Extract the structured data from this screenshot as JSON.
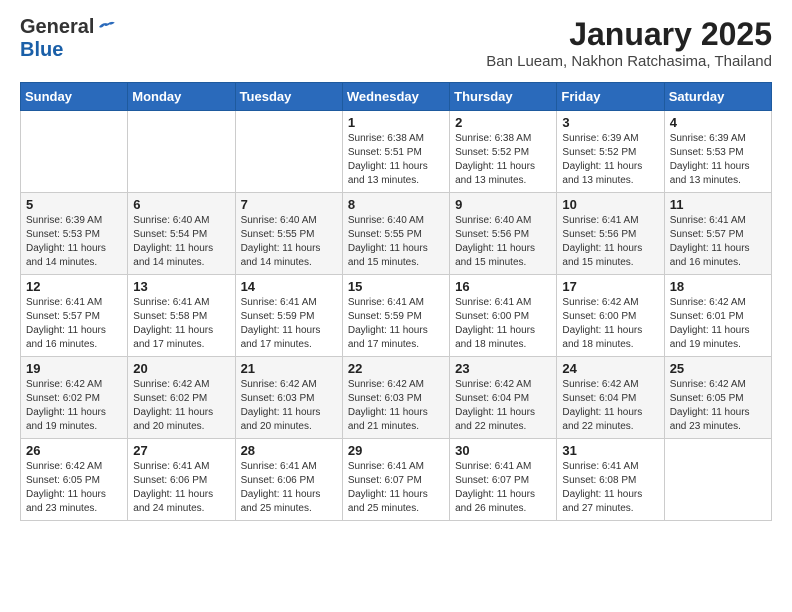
{
  "header": {
    "logo_general": "General",
    "logo_blue": "Blue",
    "month_title": "January 2025",
    "subtitle": "Ban Lueam, Nakhon Ratchasima, Thailand"
  },
  "days_of_week": [
    "Sunday",
    "Monday",
    "Tuesday",
    "Wednesday",
    "Thursday",
    "Friday",
    "Saturday"
  ],
  "weeks": [
    [
      {
        "day": "",
        "info": ""
      },
      {
        "day": "",
        "info": ""
      },
      {
        "day": "",
        "info": ""
      },
      {
        "day": "1",
        "info": "Sunrise: 6:38 AM\nSunset: 5:51 PM\nDaylight: 11 hours\nand 13 minutes."
      },
      {
        "day": "2",
        "info": "Sunrise: 6:38 AM\nSunset: 5:52 PM\nDaylight: 11 hours\nand 13 minutes."
      },
      {
        "day": "3",
        "info": "Sunrise: 6:39 AM\nSunset: 5:52 PM\nDaylight: 11 hours\nand 13 minutes."
      },
      {
        "day": "4",
        "info": "Sunrise: 6:39 AM\nSunset: 5:53 PM\nDaylight: 11 hours\nand 13 minutes."
      }
    ],
    [
      {
        "day": "5",
        "info": "Sunrise: 6:39 AM\nSunset: 5:53 PM\nDaylight: 11 hours\nand 14 minutes."
      },
      {
        "day": "6",
        "info": "Sunrise: 6:40 AM\nSunset: 5:54 PM\nDaylight: 11 hours\nand 14 minutes."
      },
      {
        "day": "7",
        "info": "Sunrise: 6:40 AM\nSunset: 5:55 PM\nDaylight: 11 hours\nand 14 minutes."
      },
      {
        "day": "8",
        "info": "Sunrise: 6:40 AM\nSunset: 5:55 PM\nDaylight: 11 hours\nand 15 minutes."
      },
      {
        "day": "9",
        "info": "Sunrise: 6:40 AM\nSunset: 5:56 PM\nDaylight: 11 hours\nand 15 minutes."
      },
      {
        "day": "10",
        "info": "Sunrise: 6:41 AM\nSunset: 5:56 PM\nDaylight: 11 hours\nand 15 minutes."
      },
      {
        "day": "11",
        "info": "Sunrise: 6:41 AM\nSunset: 5:57 PM\nDaylight: 11 hours\nand 16 minutes."
      }
    ],
    [
      {
        "day": "12",
        "info": "Sunrise: 6:41 AM\nSunset: 5:57 PM\nDaylight: 11 hours\nand 16 minutes."
      },
      {
        "day": "13",
        "info": "Sunrise: 6:41 AM\nSunset: 5:58 PM\nDaylight: 11 hours\nand 17 minutes."
      },
      {
        "day": "14",
        "info": "Sunrise: 6:41 AM\nSunset: 5:59 PM\nDaylight: 11 hours\nand 17 minutes."
      },
      {
        "day": "15",
        "info": "Sunrise: 6:41 AM\nSunset: 5:59 PM\nDaylight: 11 hours\nand 17 minutes."
      },
      {
        "day": "16",
        "info": "Sunrise: 6:41 AM\nSunset: 6:00 PM\nDaylight: 11 hours\nand 18 minutes."
      },
      {
        "day": "17",
        "info": "Sunrise: 6:42 AM\nSunset: 6:00 PM\nDaylight: 11 hours\nand 18 minutes."
      },
      {
        "day": "18",
        "info": "Sunrise: 6:42 AM\nSunset: 6:01 PM\nDaylight: 11 hours\nand 19 minutes."
      }
    ],
    [
      {
        "day": "19",
        "info": "Sunrise: 6:42 AM\nSunset: 6:02 PM\nDaylight: 11 hours\nand 19 minutes."
      },
      {
        "day": "20",
        "info": "Sunrise: 6:42 AM\nSunset: 6:02 PM\nDaylight: 11 hours\nand 20 minutes."
      },
      {
        "day": "21",
        "info": "Sunrise: 6:42 AM\nSunset: 6:03 PM\nDaylight: 11 hours\nand 20 minutes."
      },
      {
        "day": "22",
        "info": "Sunrise: 6:42 AM\nSunset: 6:03 PM\nDaylight: 11 hours\nand 21 minutes."
      },
      {
        "day": "23",
        "info": "Sunrise: 6:42 AM\nSunset: 6:04 PM\nDaylight: 11 hours\nand 22 minutes."
      },
      {
        "day": "24",
        "info": "Sunrise: 6:42 AM\nSunset: 6:04 PM\nDaylight: 11 hours\nand 22 minutes."
      },
      {
        "day": "25",
        "info": "Sunrise: 6:42 AM\nSunset: 6:05 PM\nDaylight: 11 hours\nand 23 minutes."
      }
    ],
    [
      {
        "day": "26",
        "info": "Sunrise: 6:42 AM\nSunset: 6:05 PM\nDaylight: 11 hours\nand 23 minutes."
      },
      {
        "day": "27",
        "info": "Sunrise: 6:41 AM\nSunset: 6:06 PM\nDaylight: 11 hours\nand 24 minutes."
      },
      {
        "day": "28",
        "info": "Sunrise: 6:41 AM\nSunset: 6:06 PM\nDaylight: 11 hours\nand 25 minutes."
      },
      {
        "day": "29",
        "info": "Sunrise: 6:41 AM\nSunset: 6:07 PM\nDaylight: 11 hours\nand 25 minutes."
      },
      {
        "day": "30",
        "info": "Sunrise: 6:41 AM\nSunset: 6:07 PM\nDaylight: 11 hours\nand 26 minutes."
      },
      {
        "day": "31",
        "info": "Sunrise: 6:41 AM\nSunset: 6:08 PM\nDaylight: 11 hours\nand 27 minutes."
      },
      {
        "day": "",
        "info": ""
      }
    ]
  ]
}
